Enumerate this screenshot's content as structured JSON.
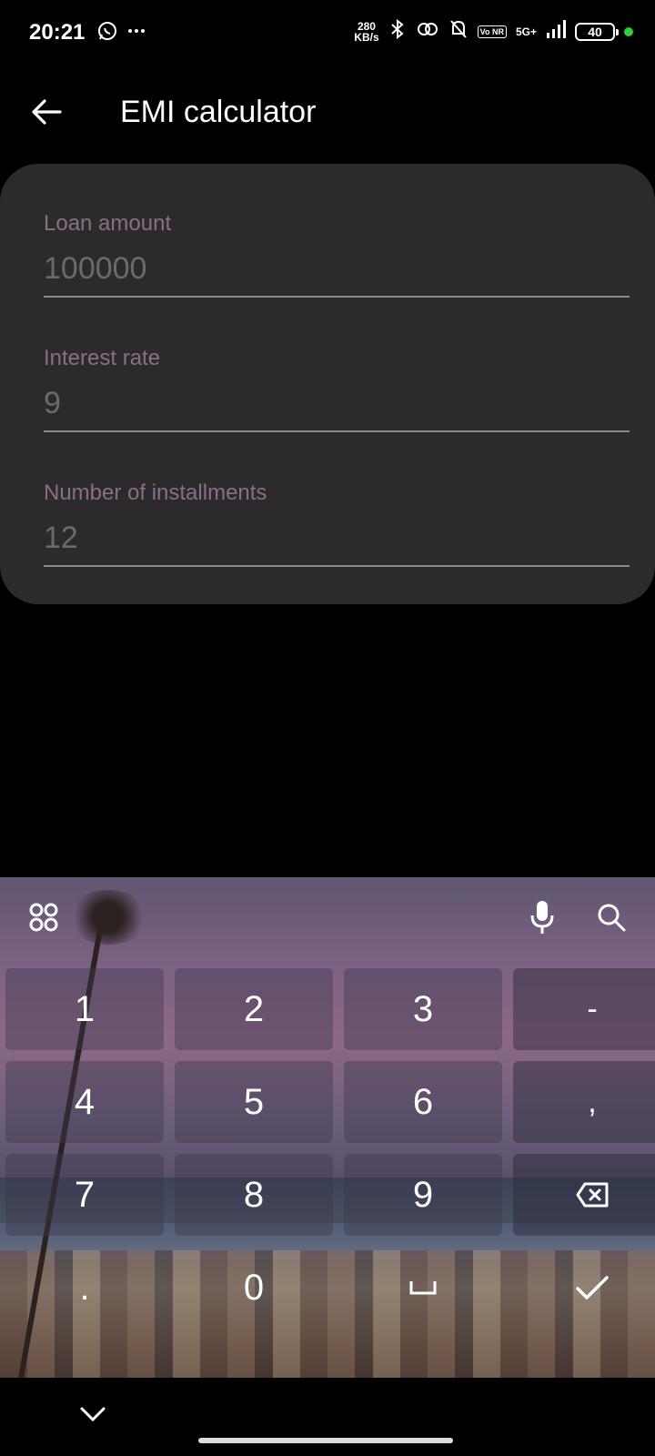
{
  "status": {
    "time": "20:21",
    "speed_value": "280",
    "speed_unit": "KB/s",
    "network": "5G+",
    "vo_badge": "Vo NR",
    "battery": "40",
    "icons": [
      "whatsapp-icon",
      "more-icon",
      "bluetooth-icon",
      "link-icon",
      "bell-off-icon",
      "signal-icon"
    ]
  },
  "appbar": {
    "title": "EMI calculator",
    "back_icon": "arrow-left-icon"
  },
  "form": {
    "loan": {
      "label": "Loan amount",
      "value": "100000"
    },
    "rate": {
      "label": "Interest rate",
      "value": "9"
    },
    "installments": {
      "label": "Number of installments",
      "value": "12"
    }
  },
  "keyboard": {
    "keys": [
      [
        "1",
        "2",
        "3",
        "-"
      ],
      [
        "4",
        "5",
        "6",
        ","
      ],
      [
        "7",
        "8",
        "9",
        "⌫"
      ],
      [
        ".",
        "0",
        "␣",
        "✓"
      ]
    ],
    "toolbar_icons": [
      "grid-icon",
      "mic-icon",
      "search-icon"
    ]
  },
  "navbar": {
    "icons": [
      "chevron-down-icon"
    ]
  },
  "colors": {
    "background": "#000000",
    "card": "#2b2b2b",
    "label": "#8a6e86",
    "value": "#6b6b6b"
  }
}
